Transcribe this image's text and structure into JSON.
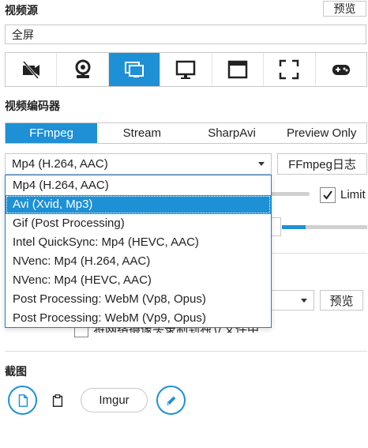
{
  "video_source": {
    "title": "视频源",
    "preview_label": "预览",
    "source_value": "全屏",
    "source_icons": [
      "camera-off-icon",
      "webcam-icon",
      "screen-icon",
      "monitor-icon",
      "window-icon",
      "region-icon",
      "gamepad-icon"
    ],
    "active_source_index": 2
  },
  "video_encoder": {
    "title": "视频编码器",
    "tabs": [
      "FFmpeg",
      "Stream",
      "SharpAvi",
      "Preview Only"
    ],
    "active_tab_index": 0,
    "selected_format": "Mp4 (H.264, AAC)",
    "log_button": "FFmpeg日志",
    "limit_label": "Limit",
    "limit_checked": true,
    "dropdown_options": [
      "Mp4 (H.264, AAC)",
      "Avi (Xvid, Mp3)",
      "Gif (Post Processing)",
      "Intel QuickSync: Mp4 (HEVC, AAC)",
      "NVenc: Mp4 (H.264, AAC)",
      "NVenc: Mp4 (HEVC, AAC)",
      "Post Processing: WebM (Vp8, Opus)",
      "Post Processing: WebM (Vp9, Opus)"
    ],
    "highlighted_option_index": 1
  },
  "webcam": {
    "preview_label": "预览",
    "separate_file_label": "将网络摄像头录制到独立文件中"
  },
  "screenshot": {
    "title": "截图",
    "imgur_label": "Imgur"
  },
  "colors": {
    "accent": "#1e90d6"
  }
}
